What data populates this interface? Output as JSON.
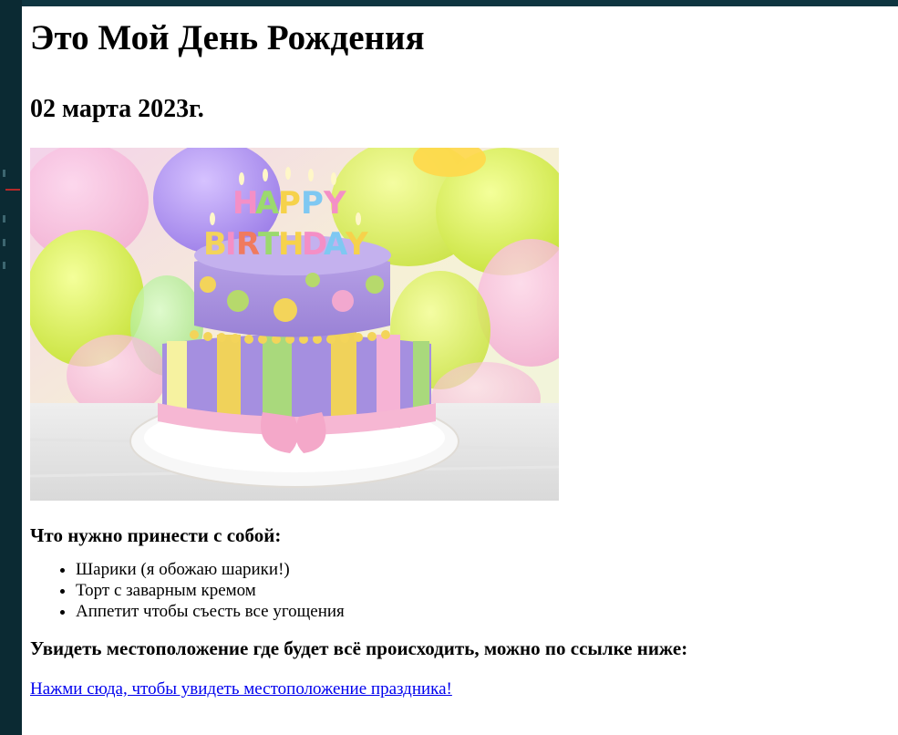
{
  "page": {
    "title": "Это Мой День Рождения",
    "date": "02 марта 2023г.",
    "bring_heading": "Что нужно принести с собой:",
    "bring_items": [
      "Шарики (я обожаю шарики!)",
      "Торт с заварным кремом",
      "Аппетит чтобы съесть все угощения"
    ],
    "location_heading": "Увидеть местоположение где будет всё происходить, можно по ссылке ниже:",
    "location_link": "Нажми сюда, чтобы увидеть местоположение праздника!",
    "image": {
      "caption_letters_line1": "HAPPY",
      "caption_letters_line2": "BIRTHDAY"
    }
  },
  "colors": {
    "link": "#0000ee",
    "page_bg": "#ffffff",
    "frame_bg": "#0b2a33"
  }
}
